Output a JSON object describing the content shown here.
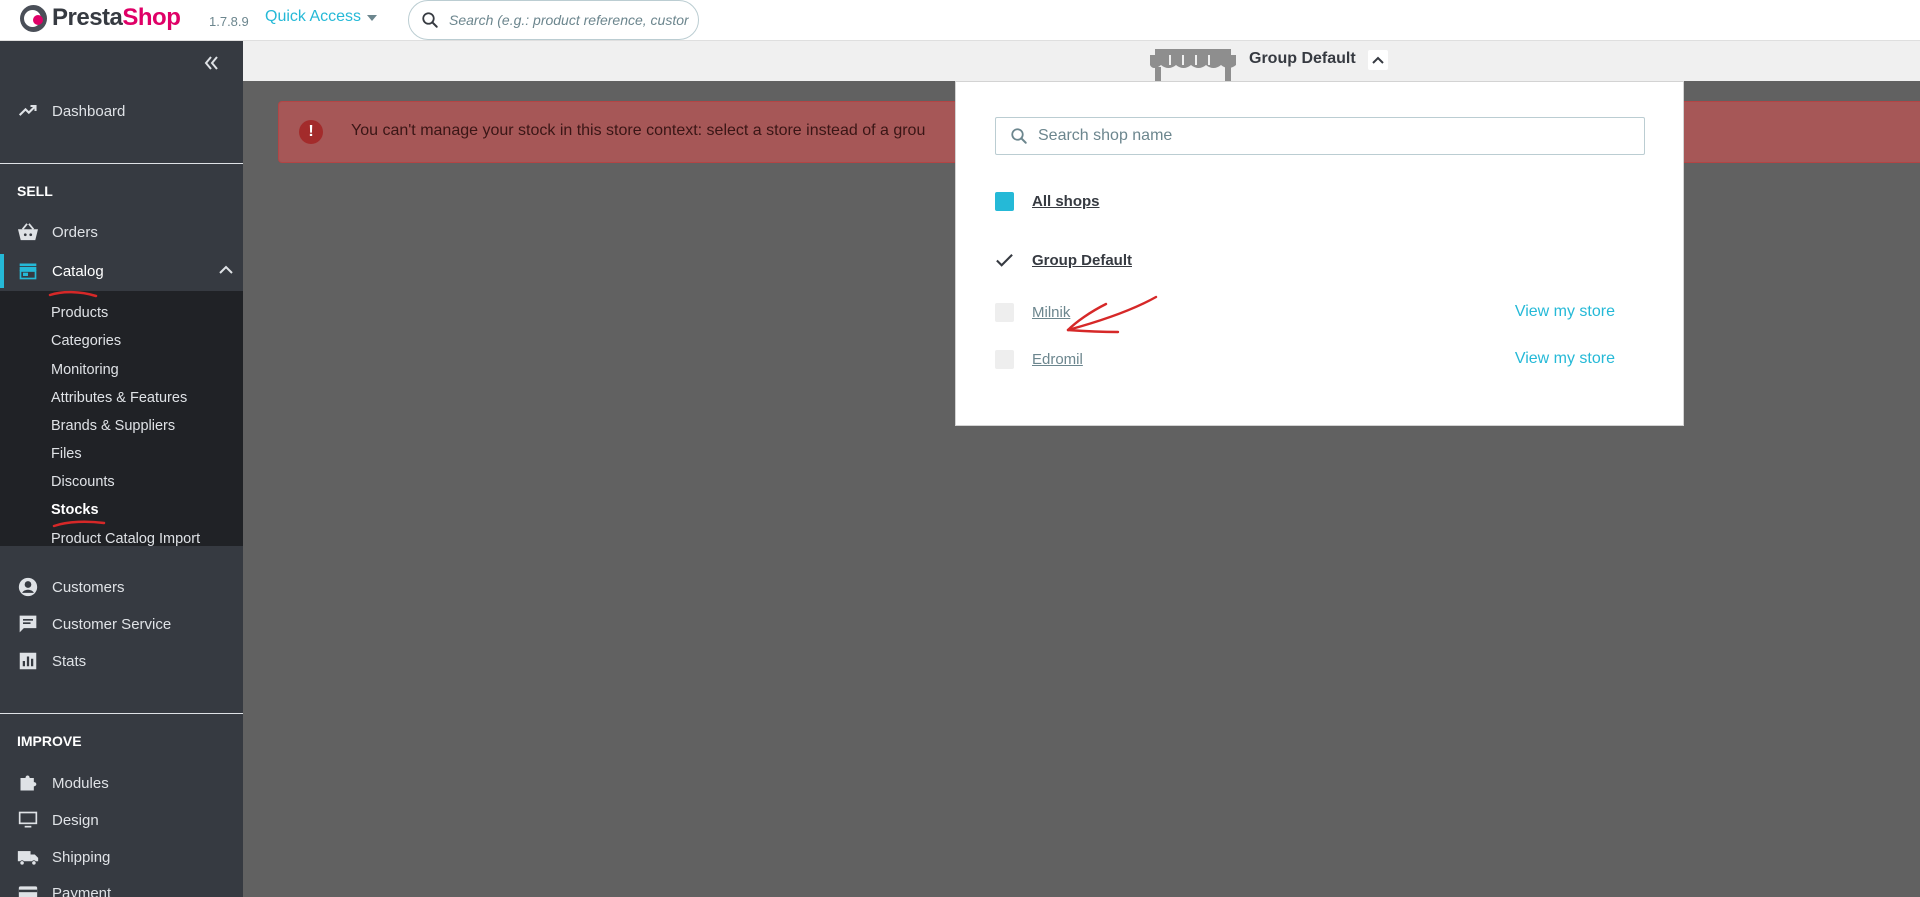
{
  "header": {
    "logo": {
      "part1": "Presta",
      "part2": "Shop"
    },
    "version": "1.7.8.9",
    "quick_access": "Quick Access",
    "search_placeholder": "Search (e.g.: product reference, custon"
  },
  "shop_context": {
    "selected": "Group Default",
    "search_placeholder": "Search shop name",
    "entries": [
      {
        "name": "All shops",
        "state": "checked"
      },
      {
        "name": "Group Default",
        "state": "current"
      },
      {
        "name": "Milnik",
        "state": "unchecked",
        "link": "View my store"
      },
      {
        "name": "Edromil",
        "state": "unchecked",
        "link": "View my store"
      }
    ]
  },
  "sidebar": {
    "dashboard": "Dashboard",
    "sell_title": "SELL",
    "orders": "Orders",
    "catalog": "Catalog",
    "catalog_sub": [
      "Products",
      "Categories",
      "Monitoring",
      "Attributes & Features",
      "Brands & Suppliers",
      "Files",
      "Discounts",
      "Stocks",
      "Product Catalog Import"
    ],
    "customers": "Customers",
    "customer_service": "Customer Service",
    "stats": "Stats",
    "improve_title": "IMPROVE",
    "modules": "Modules",
    "design": "Design",
    "shipping": "Shipping",
    "payment": "Payment"
  },
  "alert": {
    "text": "You can't manage your stock in this store context: select a store instead of a grou"
  },
  "colors": {
    "accent": "#25b9d7",
    "brand": "#df0067",
    "sidebar": "#363a41",
    "annotation": "#d62828"
  }
}
